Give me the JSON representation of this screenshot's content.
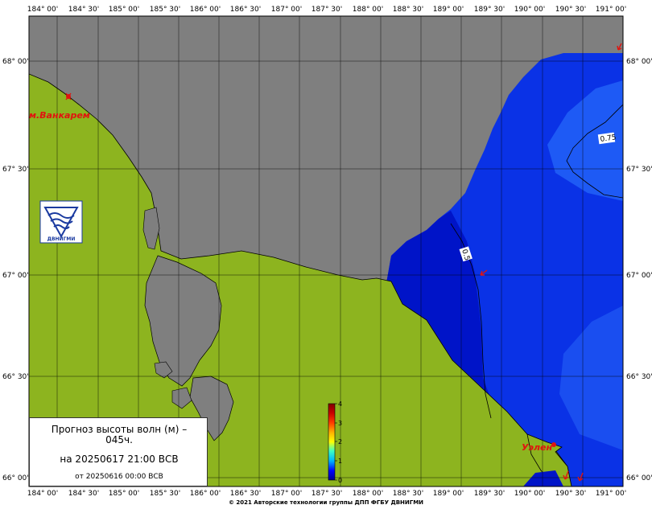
{
  "map": {
    "lon_labels": [
      "184° 00'",
      "184° 30'",
      "185° 00'",
      "185° 30'",
      "186° 00'",
      "186° 30'",
      "187° 00'",
      "187° 30'",
      "188° 00'",
      "188° 30'",
      "189° 00'",
      "189° 30'",
      "190° 00'",
      "190° 30'",
      "191° 00'"
    ],
    "lat_labels": [
      "68° 00'",
      "67° 30'",
      "67° 00'",
      "66° 30'",
      "66° 00'"
    ],
    "places": [
      {
        "name": "м.Ванкарем",
        "id": "vankarem"
      },
      {
        "name": "Уэлен",
        "id": "uelen"
      }
    ],
    "contours": [
      "0.75",
      "0.5"
    ],
    "logo_text": "ДВНИГМИ",
    "colors": {
      "land": "#8db41f",
      "nodata": "#7f7f7f",
      "sea_deep": "#0014c8",
      "sea_mid": "#0a32e6",
      "sea_light": "#1e5af5",
      "place_label": "#e0140f"
    }
  },
  "colorbar": {
    "ticks": [
      "4",
      "3",
      "2",
      "1",
      "0"
    ],
    "range": [
      0,
      4
    ]
  },
  "info": {
    "title": "Прогноз высоты волн (м) – 045ч.",
    "valid": "на 20250617 21:00 ВСВ",
    "issued": "от 20250616 00:00 ВСВ"
  },
  "footer": {
    "copyright": "© 2021 Авторские технологии группы ДПП ФГБУ ДВНИГМИ"
  }
}
